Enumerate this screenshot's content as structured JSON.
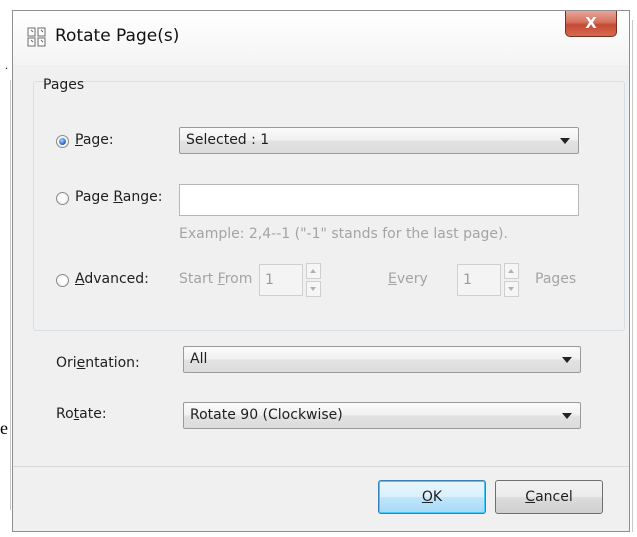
{
  "background": {
    "left_text": "e",
    "left_mark": "."
  },
  "dialog": {
    "title": "Rotate Page(s)",
    "close_label": "X",
    "icons": {
      "app": "rotate-pages-icon",
      "close": "close-icon"
    }
  },
  "pages_group": {
    "label": "Pages",
    "page_option": {
      "label_prefix": "",
      "accel": "P",
      "label_suffix": "age:",
      "checked": true,
      "value": "Selected : 1"
    },
    "range_option": {
      "label_prefix": "Page ",
      "accel": "R",
      "label_suffix": "ange:",
      "checked": false,
      "value": "",
      "example": "Example: 2,4--1 (\"-1\" stands for the last page)."
    },
    "advanced_option": {
      "label_prefix": "",
      "accel": "A",
      "label_suffix": "dvanced:",
      "checked": false,
      "start_prefix": "Start ",
      "start_accel": "F",
      "start_suffix": "rom",
      "start_value": "1",
      "every_accel": "E",
      "every_suffix": "very",
      "every_value": "1",
      "pages_label": "Pages"
    }
  },
  "orientation": {
    "label_prefix": "Ori",
    "accel": "e",
    "label_suffix": "ntation:",
    "value": "All"
  },
  "rotate": {
    "label_prefix": "Ro",
    "accel": "t",
    "label_suffix": "ate:",
    "value": "Rotate 90 (Clockwise)"
  },
  "buttons": {
    "ok": {
      "accel": "O",
      "suffix": "K"
    },
    "cancel": {
      "accel": "C",
      "suffix": "ancel"
    }
  },
  "colors": {
    "accent": "#1d5fbf",
    "close": "#c44a33",
    "default_button": "#bee6fd"
  }
}
